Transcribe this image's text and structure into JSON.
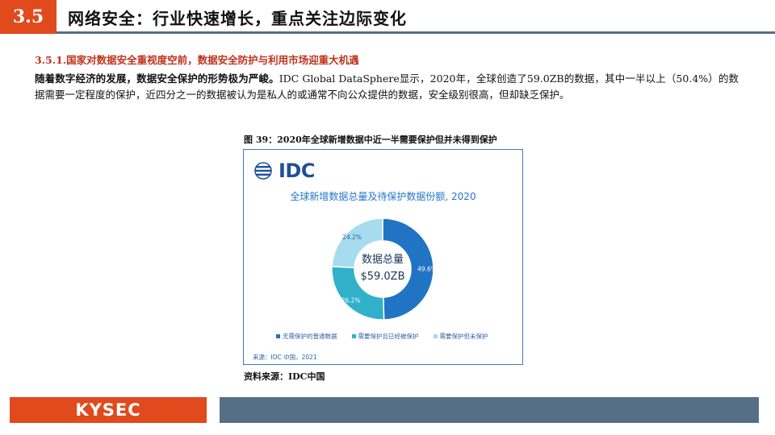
{
  "header": {
    "section_number": "3.5",
    "section_title": "网络安全：行业快速增长，重点关注边际变化"
  },
  "subsection": {
    "title": "3.5.1.国家对数据安全重视度空前，数据安全防护与利用市场迎重大机遇"
  },
  "body": {
    "lead": "随着数字经济的发展，数据安全保护的形势极为严峻。",
    "text": "IDC Global DataSphere显示，2020年，全球创造了59.0ZB的数据，其中一半以上（50.4%）的数据需要一定程度的保护，近四分之一的数据被认为是私人的或通常不向公众提供的数据，安全级别很高，但却缺乏保护。"
  },
  "figure": {
    "caption": "图 39：2020年全球新增数据中近一半需要保护但并未得到保护",
    "logo_text": "IDC",
    "chart_title": "全球新增数据总量及待保护数据份额, 2020",
    "center_label": "数据总量",
    "center_value": "$59.0ZB",
    "inner_source": "来源：IDC 中国，2021"
  },
  "chart_data": {
    "type": "pie",
    "title": "全球新增数据总量及待保护数据份额, 2020",
    "categories": [
      "无需保护的普通数据",
      "需要保护且已经被保护",
      "需要保护但未保护"
    ],
    "values": [
      49.6,
      26.2,
      24.2
    ],
    "value_labels": [
      "49.6%",
      "26.2%",
      "24.2%"
    ],
    "colors": [
      "#2173c4",
      "#31b0c9",
      "#a6dced"
    ],
    "legend_position": "bottom"
  },
  "source": {
    "text": "资料来源：IDC中国"
  },
  "footer": {
    "logo_text": "KYSEC"
  },
  "colors": {
    "accent": "#e04a1c",
    "bar": "#566f87",
    "chart_title": "#2276c9"
  }
}
